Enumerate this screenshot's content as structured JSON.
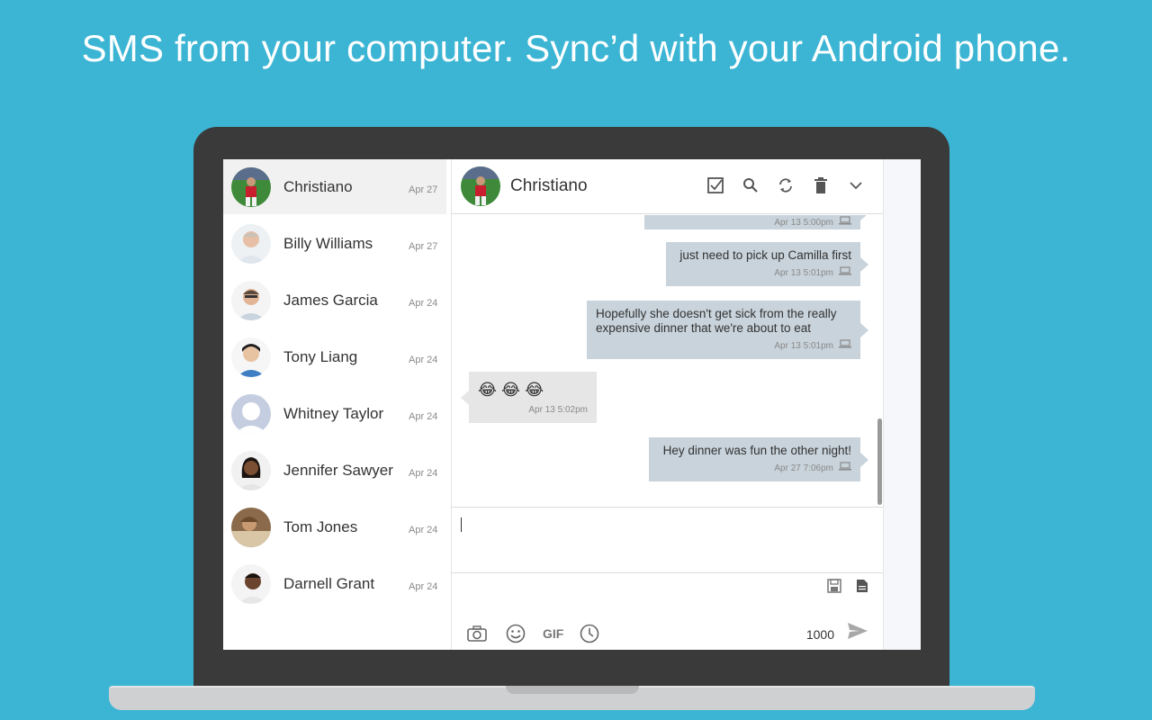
{
  "headline": "SMS from your computer. Sync’d with your Android phone.",
  "contacts": [
    {
      "name": "Christiano",
      "date": "Apr 27"
    },
    {
      "name": "Billy Williams",
      "date": "Apr 27"
    },
    {
      "name": "James Garcia",
      "date": "Apr 24"
    },
    {
      "name": "Tony Liang",
      "date": "Apr 24"
    },
    {
      "name": "Whitney Taylor",
      "date": "Apr 24"
    },
    {
      "name": "Jennifer Sawyer",
      "date": "Apr 24"
    },
    {
      "name": "Tom Jones",
      "date": "Apr 24"
    },
    {
      "name": "Darnell Grant",
      "date": "Apr 24"
    }
  ],
  "chat": {
    "title": "Christiano",
    "messages": [
      {
        "text": "",
        "time": "Apr 13 5:00pm"
      },
      {
        "text": "just need to pick up Camilla first",
        "time": "Apr 13 5:01pm"
      },
      {
        "text": "Hopefully she doesn't get sick from the really expensive dinner that we're about to eat",
        "time": "Apr 13 5:01pm"
      },
      {
        "text": "😂 😂 😂",
        "time": "Apr 13 5:02pm"
      },
      {
        "text": "Hey dinner was fun the other night!",
        "time": "Apr 27 7:06pm"
      }
    ]
  },
  "compose": {
    "gif_label": "GIF",
    "char_count": "1000"
  },
  "colors": {
    "background": "#3cb5d4",
    "outgoing_bubble": "#c8d3db",
    "incoming_bubble": "#e6e6e6"
  }
}
